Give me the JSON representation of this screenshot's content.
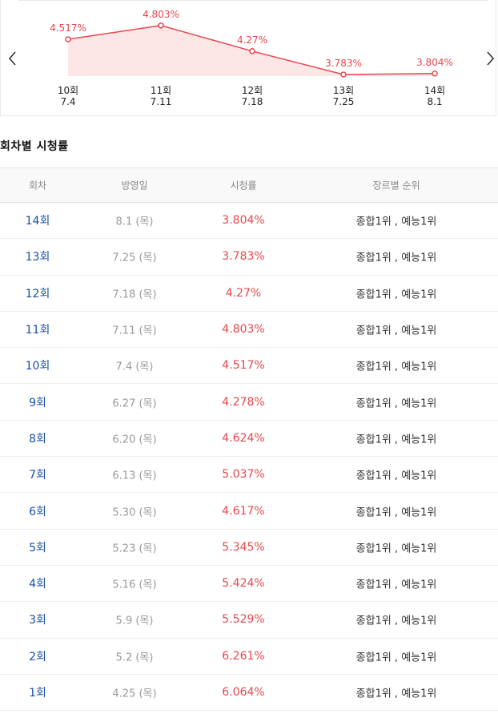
{
  "chart_data": {
    "type": "line",
    "categories": [
      "10회",
      "11회",
      "12회",
      "13회",
      "14회"
    ],
    "dates": [
      "7.4",
      "7.11",
      "7.18",
      "7.25",
      "8.1"
    ],
    "values": [
      4.517,
      4.803,
      4.27,
      3.783,
      3.804
    ],
    "value_labels": [
      "4.517%",
      "4.803%",
      "4.27%",
      "3.783%",
      "3.804%"
    ],
    "ylim": [
      3.5,
      5.0
    ],
    "grid": false,
    "colors": {
      "line": "#e8474d",
      "fill": "#fde6e6"
    }
  },
  "nav": {
    "prev_icon": "chevron-left-icon",
    "next_icon": "chevron-right-icon"
  },
  "section_title": "회차별 시청률",
  "table": {
    "headers": {
      "episode": "회차",
      "air_date": "방영일",
      "rating": "시청률",
      "rank": "장르별 순위"
    },
    "rows": [
      {
        "episode": "14회",
        "air_date": "8.1 (목)",
        "rating": "3.804%",
        "rank": "종합1위 , 예능1위"
      },
      {
        "episode": "13회",
        "air_date": "7.25 (목)",
        "rating": "3.783%",
        "rank": "종합1위 , 예능1위"
      },
      {
        "episode": "12회",
        "air_date": "7.18 (목)",
        "rating": "4.27%",
        "rank": "종합1위 , 예능1위"
      },
      {
        "episode": "11회",
        "air_date": "7.11 (목)",
        "rating": "4.803%",
        "rank": "종합1위 , 예능1위"
      },
      {
        "episode": "10회",
        "air_date": "7.4 (목)",
        "rating": "4.517%",
        "rank": "종합1위 , 예능1위"
      },
      {
        "episode": "9회",
        "air_date": "6.27 (목)",
        "rating": "4.278%",
        "rank": "종합1위 , 예능1위"
      },
      {
        "episode": "8회",
        "air_date": "6.20 (목)",
        "rating": "4.624%",
        "rank": "종합1위 , 예능1위"
      },
      {
        "episode": "7회",
        "air_date": "6.13 (목)",
        "rating": "5.037%",
        "rank": "종합1위 , 예능1위"
      },
      {
        "episode": "6회",
        "air_date": "5.30 (목)",
        "rating": "4.617%",
        "rank": "종합1위 , 예능1위"
      },
      {
        "episode": "5회",
        "air_date": "5.23 (목)",
        "rating": "5.345%",
        "rank": "종합1위 , 예능1위"
      },
      {
        "episode": "4회",
        "air_date": "5.16 (목)",
        "rating": "5.424%",
        "rank": "종합1위 , 예능1위"
      },
      {
        "episode": "3회",
        "air_date": "5.9 (목)",
        "rating": "5.529%",
        "rank": "종합1위 , 예능1위"
      },
      {
        "episode": "2회",
        "air_date": "5.2 (목)",
        "rating": "6.261%",
        "rank": "종합1위 , 예능1위"
      },
      {
        "episode": "1회",
        "air_date": "4.25 (목)",
        "rating": "6.064%",
        "rank": "종합1위 , 예능1위"
      }
    ]
  }
}
